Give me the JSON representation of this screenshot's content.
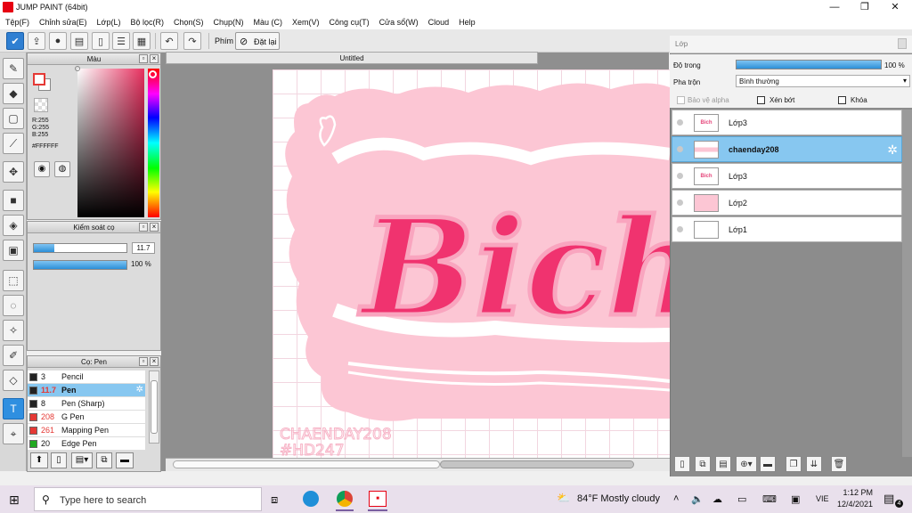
{
  "window": {
    "title": "JUMP PAINT (64bit)",
    "min": "—",
    "max": "❐",
    "close": "✕"
  },
  "menu": [
    "Tệp(F)",
    "Chỉnh sửa(E)",
    "Lớp(L)",
    "Bộ lọc(R)",
    "Chọn(S)",
    "Chụp(N)",
    "Màu (C)",
    "Xem(V)",
    "Công cụ(T)",
    "Cửa sổ(W)",
    "Cloud",
    "Help"
  ],
  "toolbar": {
    "key_label": "Phím",
    "reset_label": "Đặt lại"
  },
  "color_panel": {
    "title": "Màu",
    "r": "R:255",
    "g": "G:255",
    "b": "B:255",
    "hex": "#FFFFFF",
    "fg": "#ffffff",
    "bg": "#ffffff"
  },
  "brush_control": {
    "title": "Kiểm soát cọ",
    "size": "11.7",
    "opacity": "100 %",
    "size_fraction": 0.22,
    "opacity_fraction": 1.0
  },
  "brush_list": {
    "title": "Cọ: Pen",
    "items": [
      {
        "size": "3",
        "name": "Pencil",
        "color": "#222222",
        "red": false
      },
      {
        "size": "11.7",
        "name": "Pen",
        "color": "#222222",
        "red": true,
        "selected": true
      },
      {
        "size": "8",
        "name": "Pen (Sharp)",
        "color": "#222222",
        "red": false
      },
      {
        "size": "208",
        "name": "G Pen",
        "color": "#e53935",
        "red": true
      },
      {
        "size": "261",
        "name": "Mapping Pen",
        "color": "#e53935",
        "red": true
      },
      {
        "size": "20",
        "name": "Edge Pen",
        "color": "#22aa22",
        "red": false
      }
    ]
  },
  "document": {
    "tab": "Untitled",
    "watermark1": "CHAENDAY208",
    "watermark2": "#HD247",
    "art_text": "Bich"
  },
  "layer_panel": {
    "title": "Lớp",
    "opacity_label": "Độ trong",
    "opacity_value": "100 %",
    "blend_label": "Pha trộn",
    "blend_value": "Bình thường",
    "protect_alpha": "Bảo vệ alpha",
    "clip": "Xén bớt",
    "lock": "Khóa",
    "layers": [
      {
        "name": "Lớp3",
        "thumb": "Bich",
        "selected": false
      },
      {
        "name": "chaenday208",
        "thumb": "",
        "selected": true
      },
      {
        "name": "Lớp3",
        "thumb": "Bich",
        "selected": false
      },
      {
        "name": "Lớp2",
        "thumb": "",
        "selected": false
      },
      {
        "name": "Lớp1",
        "thumb": "",
        "selected": false
      }
    ]
  },
  "taskbar": {
    "search_placeholder": "Type here to search",
    "weather": "84°F  Mostly cloudy",
    "lang": "VIE",
    "time": "1:12 PM",
    "date": "12/4/2021",
    "notif_count": "4"
  }
}
